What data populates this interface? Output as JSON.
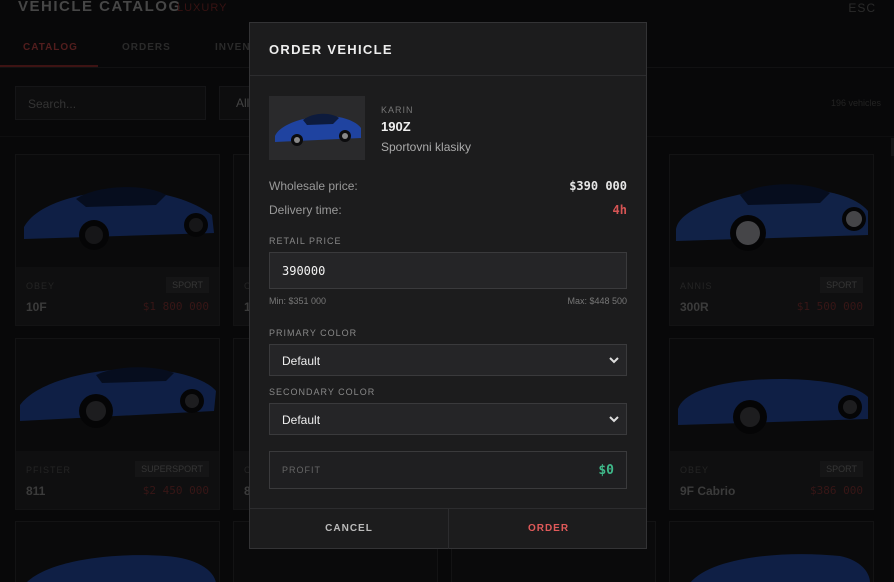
{
  "header": {
    "title": "VEHICLE CATALOG",
    "badge": "LUXURY",
    "close_hint": "ESC"
  },
  "tabs": [
    {
      "label": "CATALOG",
      "active": true
    },
    {
      "label": "ORDERS",
      "active": false
    },
    {
      "label": "INVEN",
      "active": false
    }
  ],
  "filters": {
    "search_placeholder": "Search...",
    "class_filter": "All",
    "vehicle_count": "196 vehicles"
  },
  "catalog": [
    {
      "brand": "OBEY",
      "name": "10F",
      "class": "SPORT",
      "price": "$1 800 000"
    },
    {
      "brand": "C",
      "name": "1",
      "class": "",
      "price": ""
    },
    {
      "brand": "ANNIS",
      "name": "300R",
      "class": "SPORT",
      "price": "$1 500 000"
    },
    {
      "brand": "PFISTER",
      "name": "811",
      "class": "SUPERSPORT",
      "price": "$2 450 000"
    },
    {
      "brand": "C",
      "name": "8",
      "class": "",
      "price": ""
    },
    {
      "brand": "OBEY",
      "name": "9F Cabrio",
      "class": "SPORT",
      "price": "$386 000"
    }
  ],
  "modal": {
    "title": "ORDER VEHICLE",
    "vehicle": {
      "brand": "KARIN",
      "model": "190Z",
      "class": "Sportovni klasiky"
    },
    "wholesale_label": "Wholesale price:",
    "wholesale_value": "$390 000",
    "delivery_label": "Delivery time:",
    "delivery_value": "4h",
    "retail_label": "RETAIL PRICE",
    "retail_value": "390000",
    "retail_min": "Min: $351 000",
    "retail_max": "Max: $448 500",
    "primary_label": "PRIMARY COLOR",
    "primary_value": "Default",
    "secondary_label": "SECONDARY COLOR",
    "secondary_value": "Default",
    "profit_label": "PROFIT",
    "profit_value": "$0",
    "cancel_label": "CANCEL",
    "order_label": "ORDER"
  },
  "colors": {
    "accent": "#d65454",
    "profit": "#3fb98a",
    "car": "#1e3f8a"
  }
}
